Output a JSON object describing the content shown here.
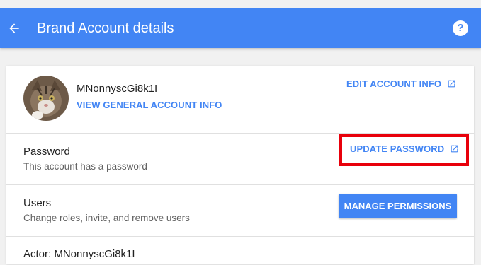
{
  "header": {
    "title": "Brand Account details",
    "back_icon": "arrow-back-icon",
    "help_label": "?"
  },
  "account": {
    "name": "MNonnyscGi8k1I",
    "view_info_label": "VIEW GENERAL ACCOUNT INFO",
    "edit_info_label": "EDIT ACCOUNT INFO"
  },
  "password": {
    "title": "Password",
    "subtitle": "This account has a password",
    "update_label": "UPDATE PASSWORD"
  },
  "users": {
    "title": "Users",
    "subtitle": "Change roles, invite, and remove users",
    "manage_label": "MANAGE PERMISSIONS"
  },
  "partial_row": {
    "title": "Actor: MNonnyscGi8k1I"
  },
  "colors": {
    "accent": "#4285f4",
    "highlight": "#e8000b"
  }
}
